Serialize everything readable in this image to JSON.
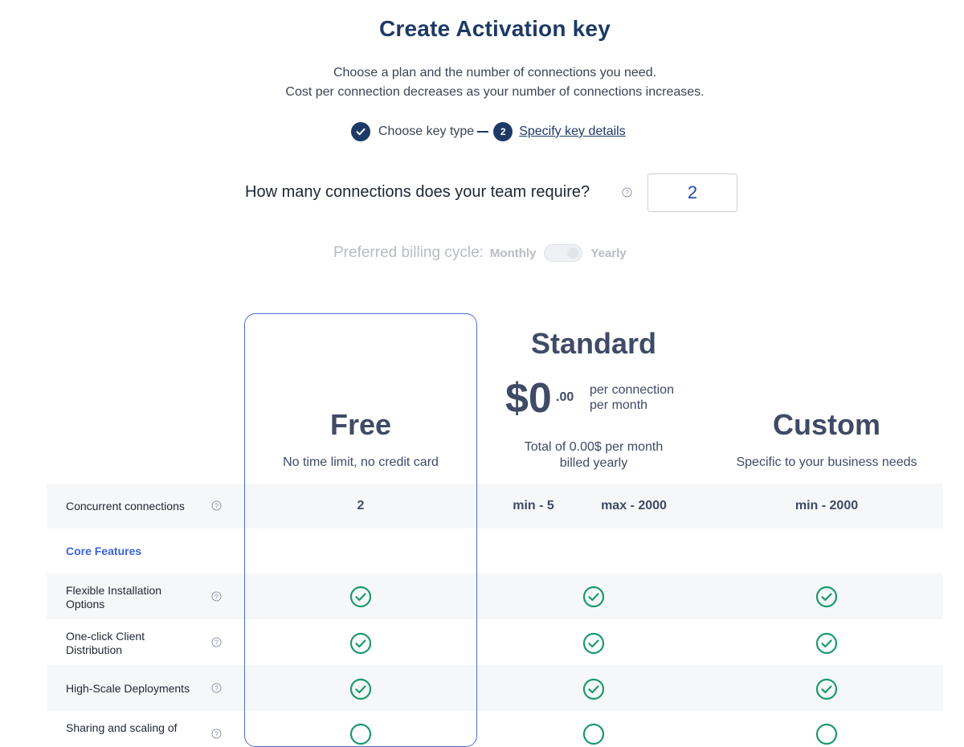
{
  "page": {
    "title": "Create Activation key",
    "subtitle_line1": "Choose a plan and the number of connections you need.",
    "subtitle_line2": "Cost per connection decreases as your number of connections increases."
  },
  "stepper": {
    "step1_label": "Choose key type",
    "step2_number": "2",
    "step2_label": "Specify key details"
  },
  "connections": {
    "question": "How many connections does your team require?",
    "value": "2"
  },
  "billing": {
    "label": "Preferred billing cycle:",
    "option_monthly": "Monthly",
    "option_yearly": "Yearly"
  },
  "plans": {
    "free": {
      "name": "Free",
      "description": "No time limit, no credit card"
    },
    "standard": {
      "name": "Standard",
      "price": "$0",
      "cents": ".00",
      "per_line1": "per connection",
      "per_line2": "per month",
      "total_line1": "Total of 0.00$ per month",
      "total_line2": "billed yearly"
    },
    "custom": {
      "name": "Custom",
      "description": "Specific to your business needs"
    }
  },
  "table": {
    "concurrent": {
      "label": "Concurrent connections",
      "free": "2",
      "standard_min": "min - 5",
      "standard_max": "max - 2000",
      "custom": "min - 2000"
    },
    "section_core": "Core Features",
    "features": [
      {
        "label_line1": "Flexible Installation",
        "label_line2": "Options"
      },
      {
        "label_line1": "One-click Client",
        "label_line2": "Distribution"
      },
      {
        "label_line1": "High-Scale Deployments",
        "label_line2": ""
      },
      {
        "label_line1": "Sharing and scaling of",
        "label_line2": ""
      }
    ]
  },
  "colors": {
    "navy": "#1d3a66",
    "accent_blue": "#4c6fd6",
    "check_green": "#1a9a6a",
    "row_shade": "#f6f7f9"
  },
  "icons": {
    "step_done": "check-circle-icon",
    "help": "question-circle-icon",
    "feature_included": "green-check-circle-icon"
  }
}
